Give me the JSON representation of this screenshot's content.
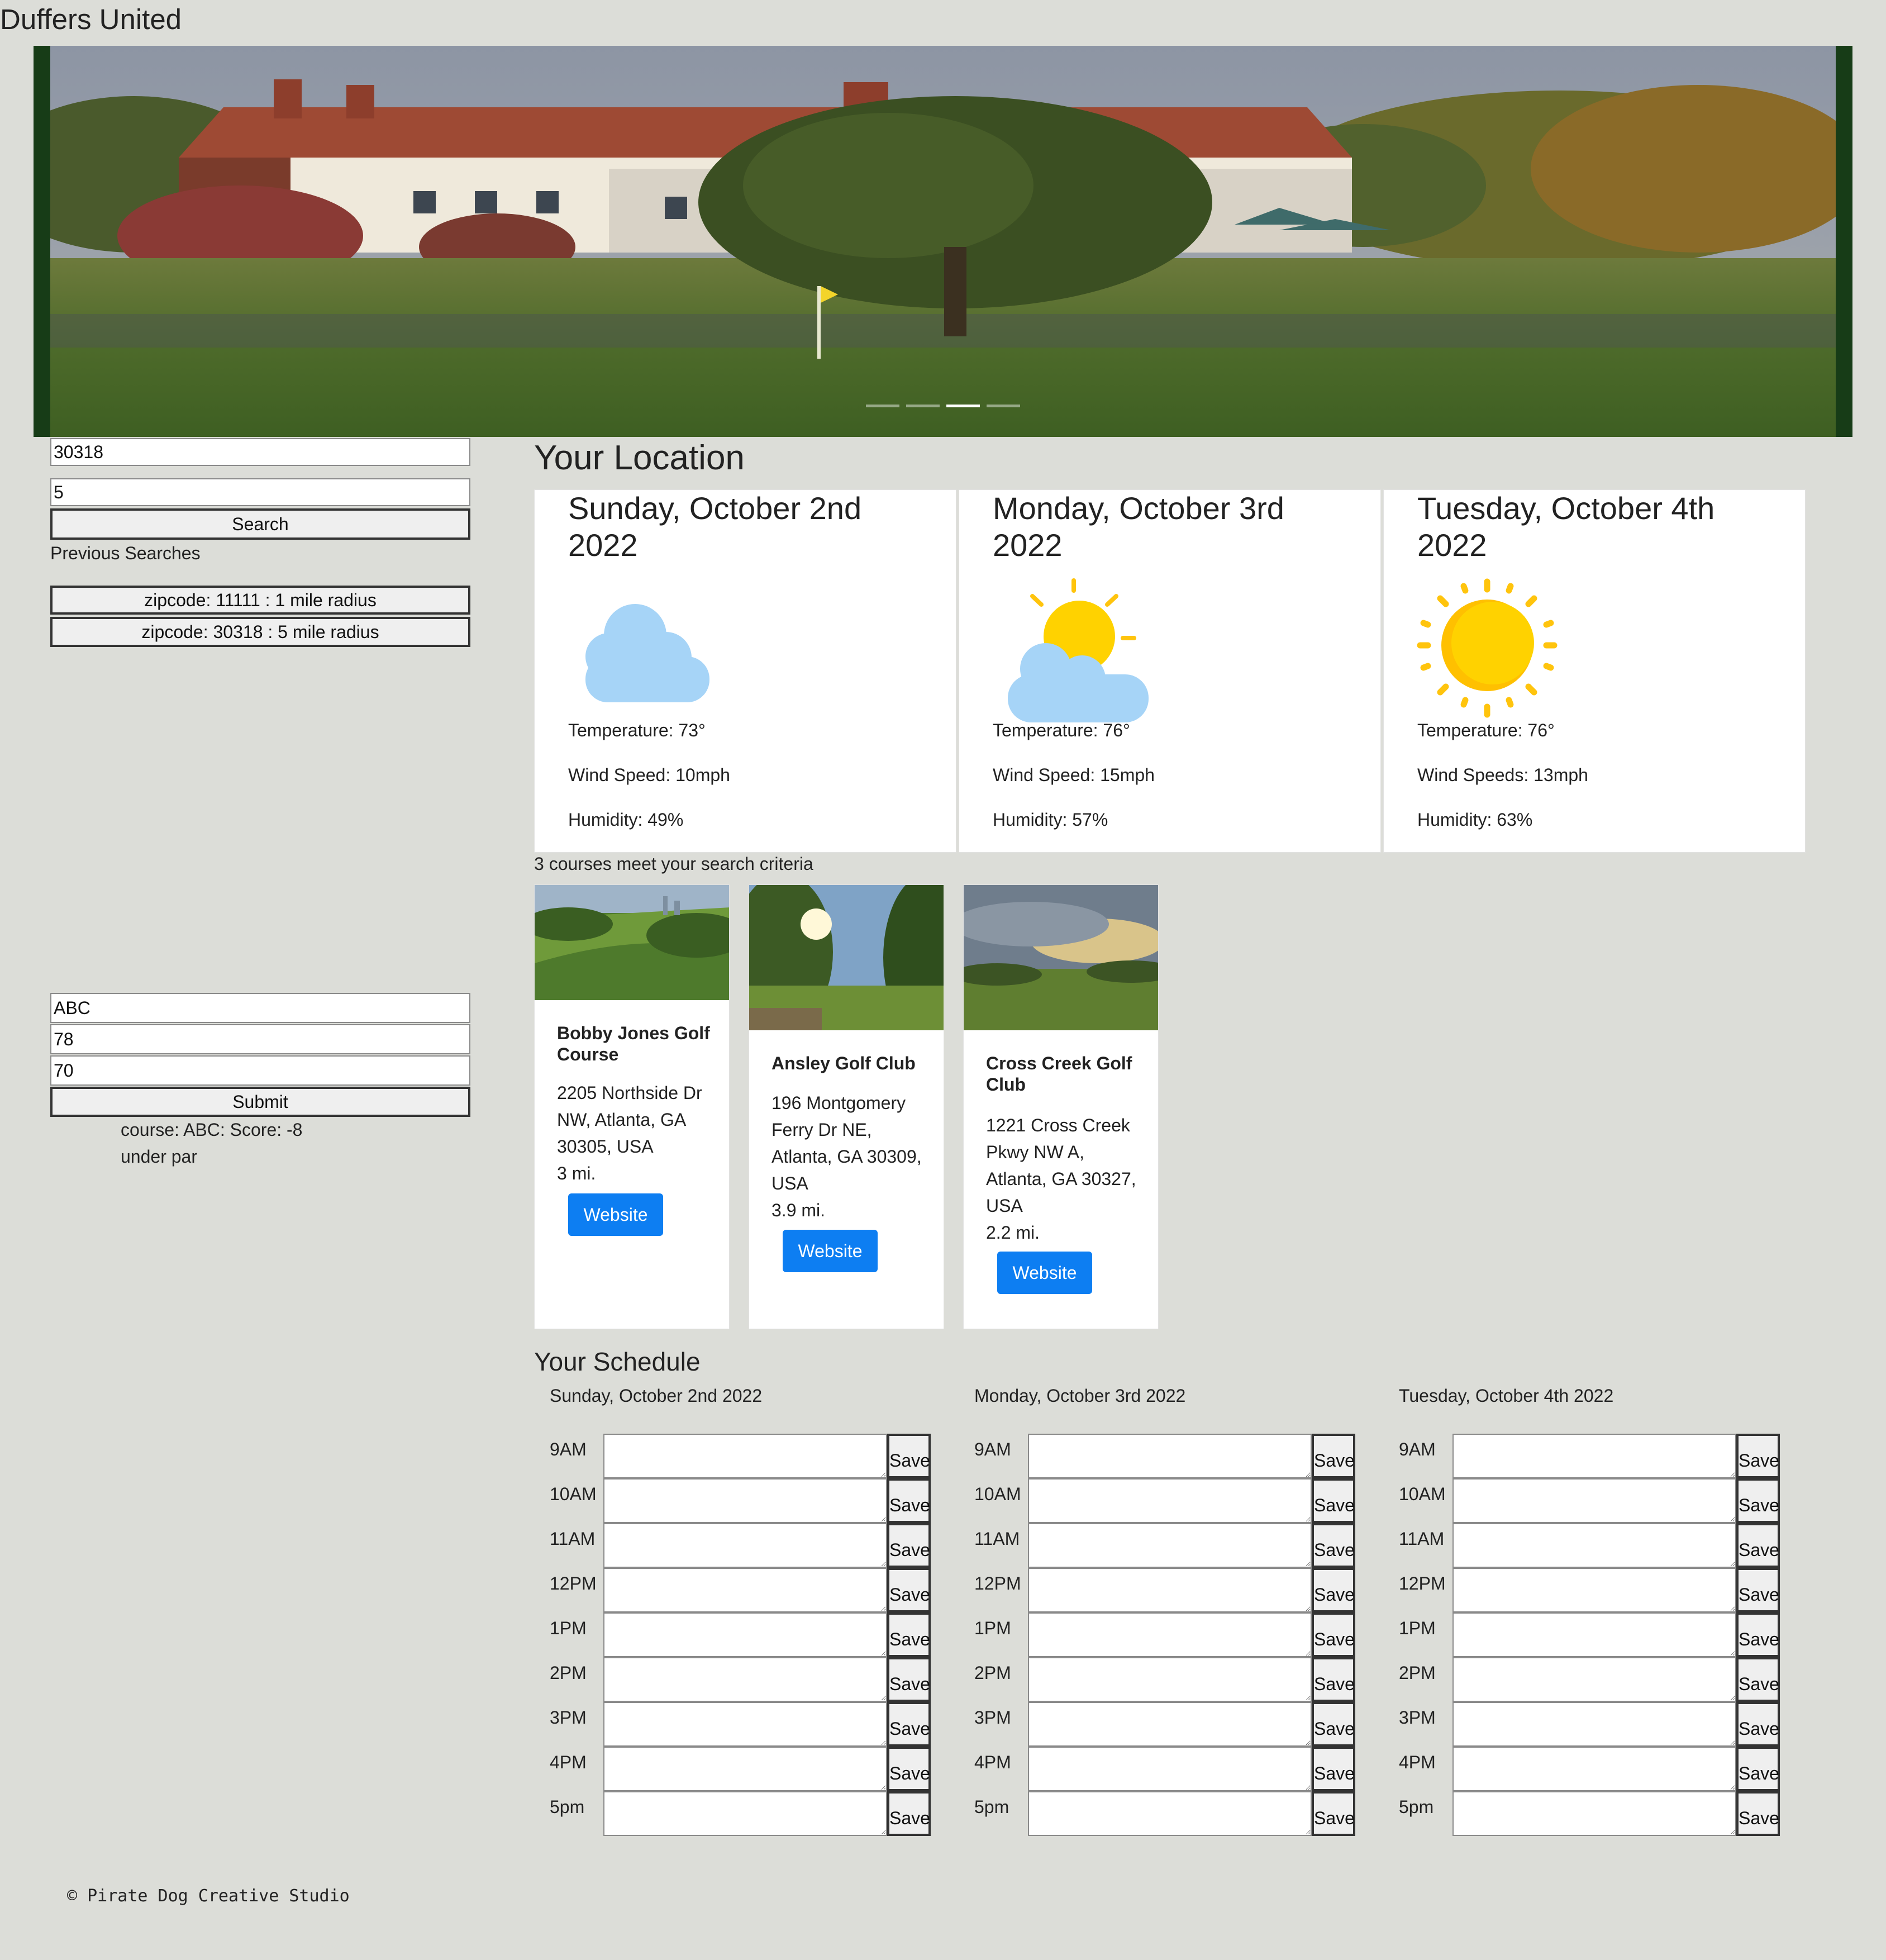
{
  "app": {
    "title": "Duffers United"
  },
  "hero": {
    "slide_count": 4,
    "active_slide": 3
  },
  "search": {
    "zipcode_value": "30318",
    "radius_value": "5",
    "button_label": "Search",
    "previous_label": "Previous Searches",
    "previous": [
      "zipcode: 11111 : 1 mile radius",
      "zipcode: 30318 : 5 mile radius"
    ]
  },
  "score_form": {
    "course_value": "ABC",
    "score_value": "78",
    "par_value": "70",
    "submit_label": "Submit",
    "result_line1": "course: ABC: Score: -8",
    "result_line2": "under par"
  },
  "weather": {
    "title": "Your Location",
    "days": [
      {
        "date": "Sunday, October 2nd 2022",
        "icon": "cloud-icon",
        "temperature": "Temperature: 73°",
        "wind": "Wind Speed: 10mph",
        "humidity": "Humidity: 49%"
      },
      {
        "date": "Monday, October 3rd 2022",
        "icon": "partly-cloudy-icon",
        "temperature": "Temperature: 76°",
        "wind": "Wind Speed: 15mph",
        "humidity": "Humidity: 57%"
      },
      {
        "date": "Tuesday, October 4th 2022",
        "icon": "sun-icon",
        "temperature": "Temperature: 76°",
        "wind": "Wind Speeds: 13mph",
        "humidity": "Humidity: 63%"
      }
    ]
  },
  "courses": {
    "count_text": "3 courses meet your search criteria",
    "items": [
      {
        "name": "Bobby Jones Golf Course",
        "address": "2205 Northside Dr NW, Atlanta, GA 30305, USA",
        "distance": "3 mi.",
        "button": "Website"
      },
      {
        "name": "Ansley Golf Club",
        "address": "196 Montgomery Ferry Dr NE, Atlanta, GA 30309, USA",
        "distance": "3.9 mi.",
        "button": "Website"
      },
      {
        "name": "Cross Creek Golf Club",
        "address": "1221 Cross Creek Pkwy NW A, Atlanta, GA 30327, USA",
        "distance": "2.2 mi.",
        "button": "Website"
      }
    ]
  },
  "schedule": {
    "title": "Your Schedule",
    "save_label": "Save",
    "times": [
      "9AM",
      "10AM",
      "11AM",
      "12PM",
      "1PM",
      "2PM",
      "3PM",
      "4PM",
      "5pm"
    ],
    "days": [
      "Sunday, October 2nd 2022",
      "Monday, October 3rd 2022",
      "Tuesday, October 4th 2022"
    ]
  },
  "footer": {
    "text": "© Pirate Dog Creative Studio"
  },
  "colors": {
    "background": "#dcddd8",
    "accent": "#0d7ef2",
    "hero_frame": "#173c17",
    "sun": "#ffd200",
    "cloud": "#a6d4f7"
  }
}
